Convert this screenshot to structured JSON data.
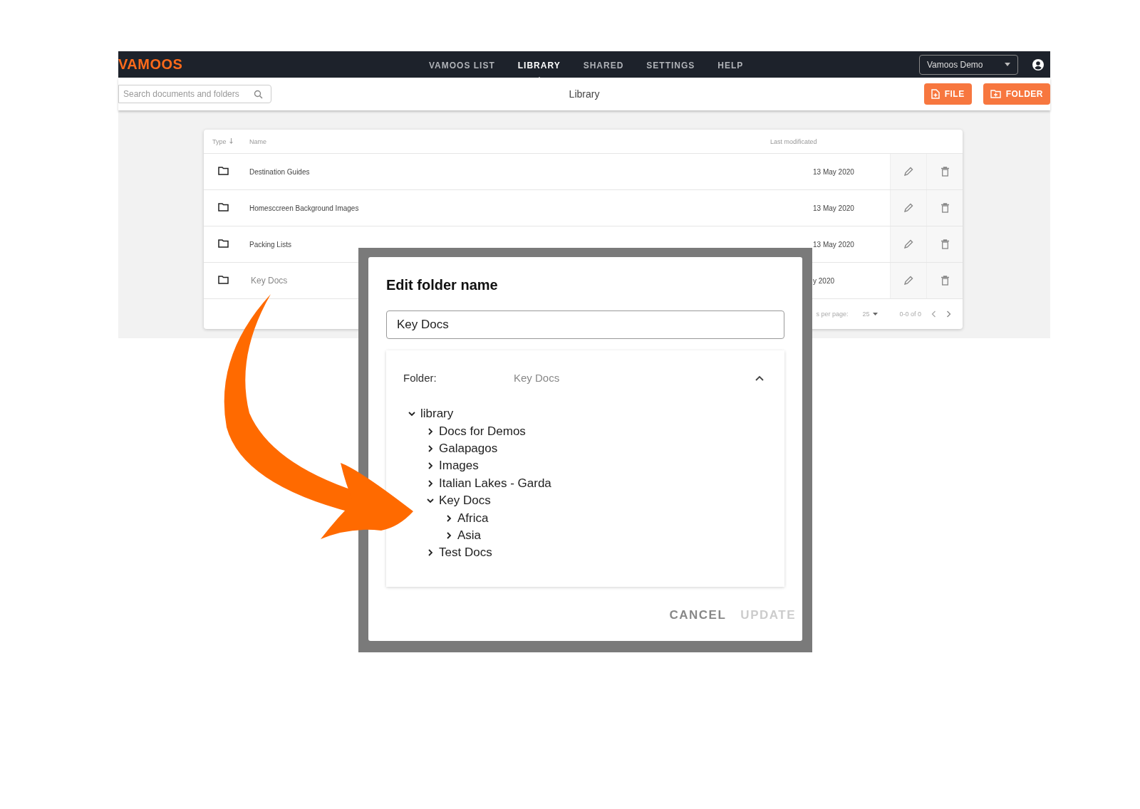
{
  "app": {
    "logo": "VAMOOS",
    "nav": [
      {
        "label": "VAMOOS LIST",
        "selected": false
      },
      {
        "label": "LIBRARY",
        "selected": true
      },
      {
        "label": "SHARED",
        "selected": false
      },
      {
        "label": "SETTINGS",
        "selected": false
      },
      {
        "label": "HELP",
        "selected": false
      }
    ],
    "account": "Vamoos Demo"
  },
  "toolbar": {
    "search_placeholder": "Search documents and folders",
    "title": "Library",
    "buttons": [
      {
        "label": "FILE",
        "kind": "file"
      },
      {
        "label": "FOLDER",
        "kind": "folder"
      }
    ]
  },
  "table": {
    "columns": {
      "type": "Type",
      "name": "Name",
      "modified": "Last modificated"
    },
    "rows": [
      {
        "name": "Destination Guides",
        "modified": "13 May 2020",
        "highlighted": false
      },
      {
        "name": "Homesccreen Background Images",
        "modified": "13 May 2020",
        "highlighted": false
      },
      {
        "name": "Packing Lists",
        "modified": "13 May 2020",
        "highlighted": false
      },
      {
        "name": "Key Docs",
        "modified": "y 2020",
        "highlighted": true
      }
    ],
    "footer": {
      "per_page_label": "s per page:",
      "per_page": "25",
      "range": "0-0 of 0"
    }
  },
  "dialog": {
    "title": "Edit folder name",
    "value": "Key Docs",
    "folder_label": "Folder:",
    "folder_value": "Key Docs",
    "tree": [
      {
        "label": "library",
        "expanded": true,
        "children": [
          {
            "label": "Docs for Demos",
            "expanded": false
          },
          {
            "label": "Galapagos",
            "expanded": false
          },
          {
            "label": "Images",
            "expanded": false
          },
          {
            "label": "Italian Lakes - Garda",
            "expanded": false
          },
          {
            "label": "Key Docs",
            "expanded": true,
            "children": [
              {
                "label": "Africa",
                "expanded": false
              },
              {
                "label": "Asia",
                "expanded": false
              }
            ]
          },
          {
            "label": "Test Docs",
            "expanded": false
          }
        ]
      }
    ],
    "buttons": [
      {
        "label": "CANCEL",
        "disabled": false
      },
      {
        "label": "UPDATE",
        "disabled": true
      }
    ]
  }
}
